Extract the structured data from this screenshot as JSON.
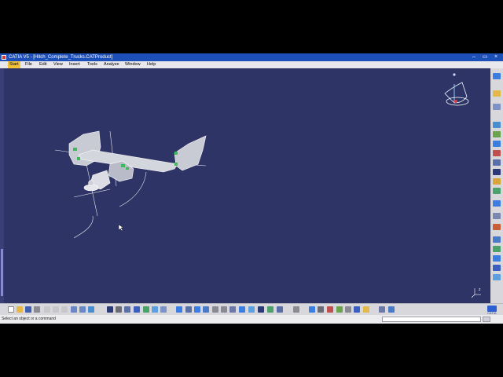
{
  "window": {
    "title": "CATIA V5 - [Hitch_Complete_Trucks.CATProduct]",
    "controls": [
      "–",
      "▭",
      "×"
    ]
  },
  "menu": {
    "items": [
      "Start",
      "File",
      "Edit",
      "View",
      "Insert",
      "Tools",
      "Analyze",
      "Window",
      "Help"
    ],
    "active": "Start"
  },
  "status": {
    "prompt": "Select an object or a command",
    "command_value": ""
  },
  "brand": {
    "logo_text": "CATIA"
  },
  "compass": {
    "axis_label": "z"
  },
  "colors": {
    "viewport_bg": "#2f3466",
    "titlebar": "#1c4fb8",
    "active_menu": "#f2c33a",
    "part_grey": "#c8cad4",
    "part_green": "#3db85a"
  }
}
